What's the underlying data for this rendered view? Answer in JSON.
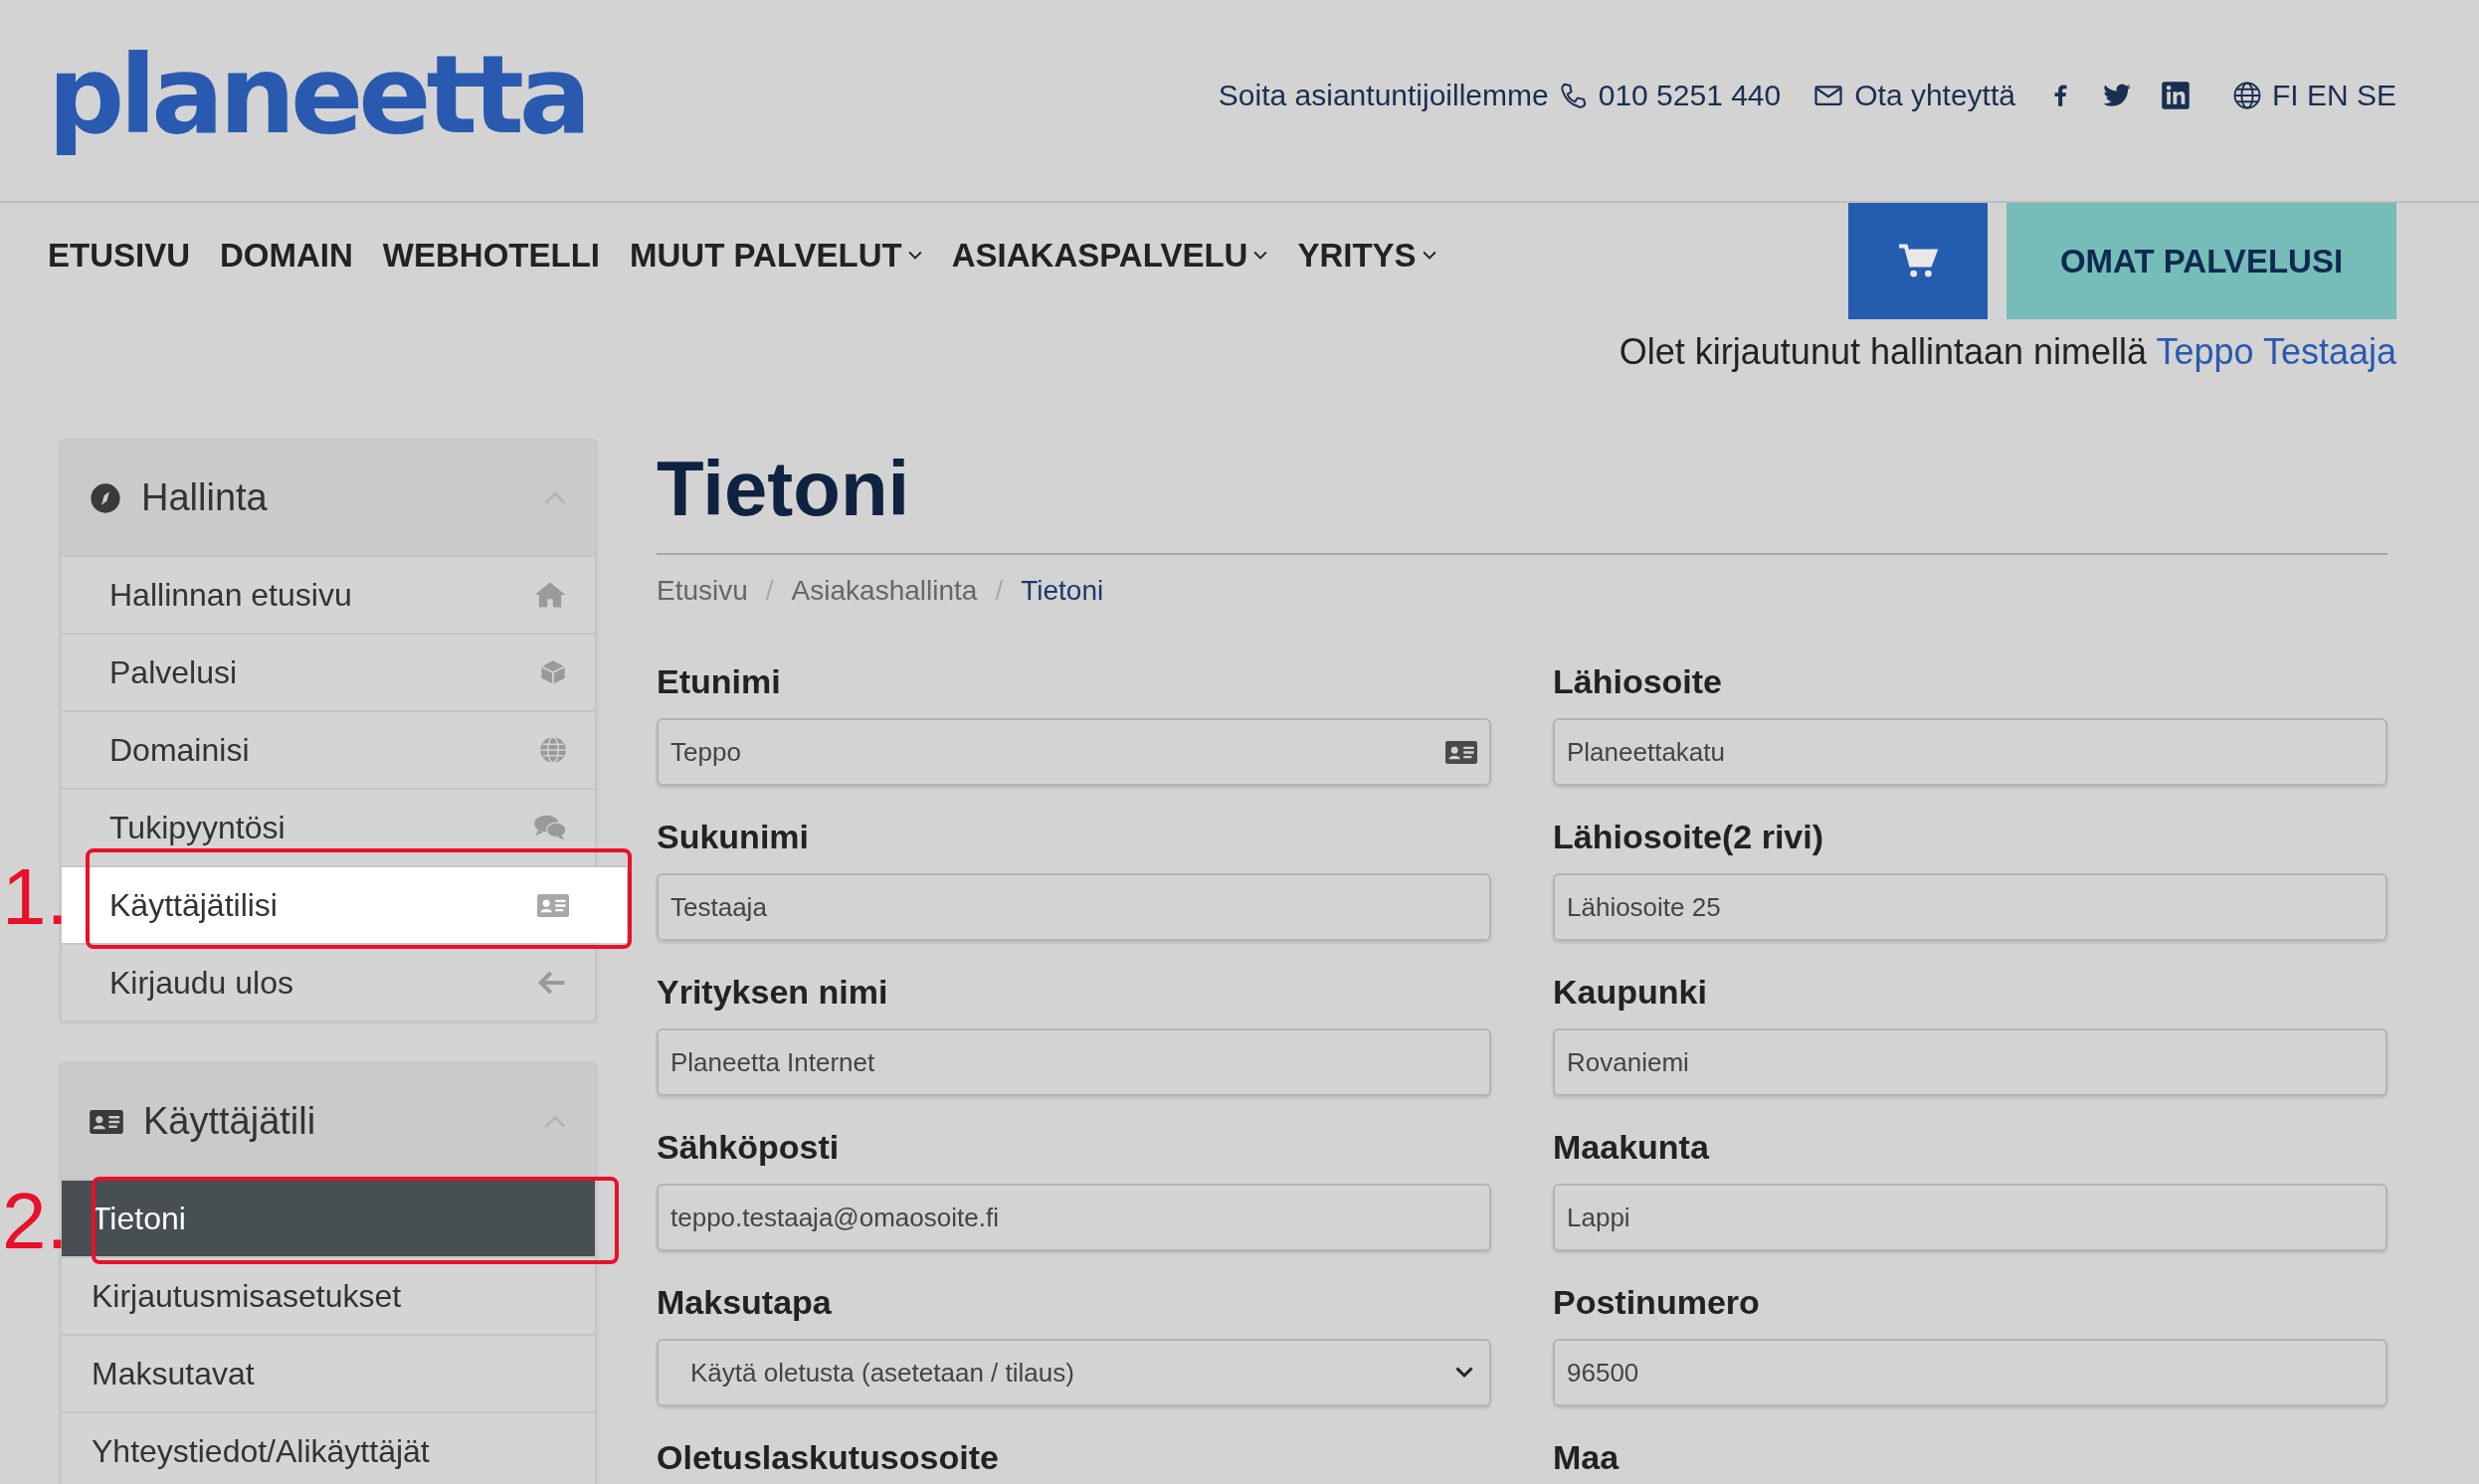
{
  "header": {
    "logo": "planeetta",
    "call_label": "Soita asiantuntijoillemme",
    "phone": "010 5251 440",
    "contact_label": "Ota yhteyttä",
    "languages": "FI EN SE"
  },
  "nav": {
    "items": [
      {
        "label": "ETUSIVU",
        "dropdown": false
      },
      {
        "label": "DOMAIN",
        "dropdown": false
      },
      {
        "label": "WEBHOTELLI",
        "dropdown": false
      },
      {
        "label": "MUUT PALVELUT",
        "dropdown": true
      },
      {
        "label": "ASIAKASPALVELU",
        "dropdown": true
      },
      {
        "label": "YRITYS",
        "dropdown": true
      }
    ],
    "account_button": "OMAT PALVELUSI"
  },
  "login_notice": {
    "text": "Olet kirjautunut hallintaan nimellä",
    "user": "Teppo Testaaja"
  },
  "sidebar": {
    "panels": [
      {
        "title": "Hallinta",
        "expanded": true,
        "items": [
          {
            "label": "Hallinnan etusivu",
            "selected": false,
            "highlighted": false
          },
          {
            "label": "Palvelusi",
            "selected": false,
            "highlighted": false
          },
          {
            "label": "Domainisi",
            "selected": false,
            "highlighted": false
          },
          {
            "label": "Tukipyyntösi",
            "selected": false,
            "highlighted": false
          },
          {
            "label": "Käyttäjätilisi",
            "selected": false,
            "highlighted": true
          },
          {
            "label": "Kirjaudu ulos",
            "selected": false,
            "highlighted": false
          }
        ]
      },
      {
        "title": "Käyttäjätili",
        "expanded": true,
        "items": [
          {
            "label": "Tietoni",
            "selected": true,
            "highlighted": false
          },
          {
            "label": "Kirjautusmisasetukset",
            "selected": false,
            "highlighted": false
          },
          {
            "label": "Maksutavat",
            "selected": false,
            "highlighted": false
          },
          {
            "label": "Yhteystiedot/Alikäyttäjät",
            "selected": false,
            "highlighted": false
          }
        ]
      }
    ]
  },
  "page": {
    "title": "Tietoni",
    "breadcrumb_separator": "/",
    "breadcrumb": [
      {
        "label": "Etusivu",
        "current": false
      },
      {
        "label": "Asiakashallinta",
        "current": false
      },
      {
        "label": "Tietoni",
        "current": true
      }
    ],
    "form_left": [
      {
        "label": "Etunimi",
        "kind": "text",
        "value": "Teppo"
      },
      {
        "label": "Sukunimi",
        "kind": "text",
        "value": "Testaaja"
      },
      {
        "label": "Yrityksen nimi",
        "kind": "text",
        "value": "Planeetta Internet"
      },
      {
        "label": "Sähköposti",
        "kind": "text",
        "value": "teppo.testaaja@omaosoite.fi"
      },
      {
        "label": "Maksutapa",
        "kind": "select",
        "value": "Käytä oletusta (asetetaan / tilaus)"
      },
      {
        "label": "Oletuslaskutusosoite",
        "kind": "label"
      }
    ],
    "form_right": [
      {
        "label": "Lähiosoite",
        "kind": "text",
        "value": "Planeettakatu"
      },
      {
        "label": "Lähiosoite(2 rivi)",
        "kind": "text",
        "value": "Lähiosoite 25"
      },
      {
        "label": "Kaupunki",
        "kind": "text",
        "value": "Rovaniemi"
      },
      {
        "label": "Maakunta",
        "kind": "text",
        "value": "Lappi"
      },
      {
        "label": "Postinumero",
        "kind": "text",
        "value": "96500"
      },
      {
        "label": "Maa",
        "kind": "label"
      }
    ]
  },
  "annotations": [
    {
      "label": "1."
    },
    {
      "label": "2."
    }
  ]
}
